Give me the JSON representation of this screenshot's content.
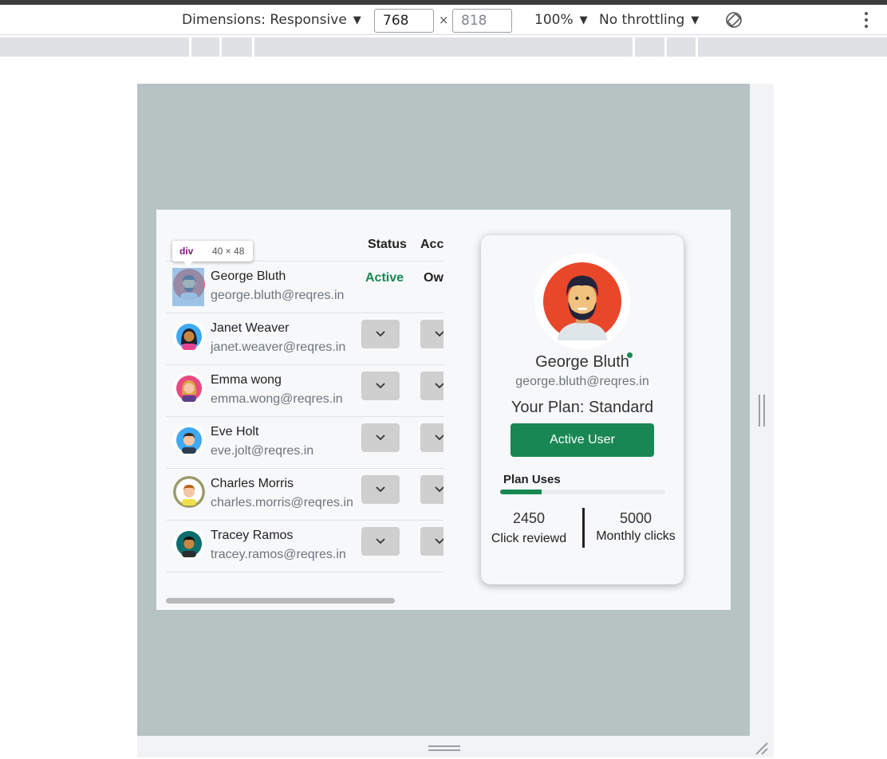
{
  "devtools": {
    "dimensions_label": "Dimensions: Responsive",
    "width_value": "768",
    "height_value": "818",
    "times": "×",
    "zoom": "100%",
    "throttling": "No throttling",
    "dropdown_arrow": "▼"
  },
  "inspector_tooltip": {
    "tag": "div",
    "size": "40 × 48"
  },
  "table": {
    "headers": {
      "status": "Status",
      "access": "Access"
    },
    "rows": [
      {
        "name": "George Bluth",
        "email": "george.bluth@reqres.in",
        "status": "Active",
        "access": "Owner",
        "avatar": "george-avatar"
      },
      {
        "name": "Janet Weaver",
        "email": "janet.weaver@reqres.in",
        "avatar": "janet-avatar"
      },
      {
        "name": "Emma wong",
        "email": "emma.wong@reqres.in",
        "avatar": "emma-avatar"
      },
      {
        "name": "Eve Holt",
        "email": "eve.jolt@reqres.in",
        "avatar": "eve-avatar"
      },
      {
        "name": "Charles Morris",
        "email": "charles.morris@reqres.in",
        "avatar": "charles-avatar"
      },
      {
        "name": "Tracey Ramos",
        "email": "tracey.ramos@reqres.in",
        "avatar": "tracey-avatar"
      }
    ]
  },
  "profile": {
    "name": "George Bluth",
    "email": "george.bluth@reqres.in",
    "plan": "Your Plan: Standard",
    "button": "Active User",
    "uses_label": "Plan Uses",
    "uses_fraction": 0.25,
    "clicks_value": "2450",
    "clicks_label": "Click reviewd",
    "monthly_value": "5000",
    "monthly_label": "Monthly clicks"
  },
  "colors": {
    "accent": "#198754",
    "viewport_bg": "#b7c3c3",
    "app_bg": "#f7f8fa",
    "dropdown_bg": "#cfcfcf"
  }
}
